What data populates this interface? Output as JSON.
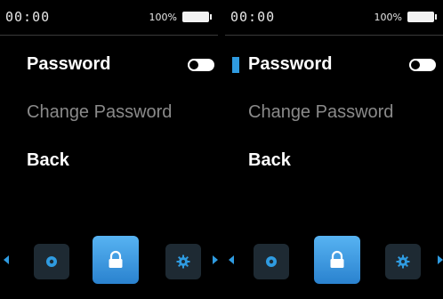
{
  "screens": [
    {
      "id": "left",
      "status": {
        "time": "00:00",
        "battery": "100%"
      },
      "menu": [
        {
          "label": "Password"
        },
        {
          "label": "Change Password"
        },
        {
          "label": "Back"
        }
      ],
      "password_toggle": "off",
      "focused": false
    },
    {
      "id": "right",
      "status": {
        "time": "00:00",
        "battery": "100%"
      },
      "menu": [
        {
          "label": "Password"
        },
        {
          "label": "Change Password"
        },
        {
          "label": "Back"
        }
      ],
      "password_toggle": "off",
      "focused": true
    }
  ],
  "nav": {
    "icons": [
      "eye-icon",
      "lock-icon",
      "gear-icon"
    ],
    "selected": "lock-icon"
  },
  "colors": {
    "accent": "#2f9be0",
    "disabled_text": "#8a8a8a",
    "tile_dark": "#1e2a33"
  }
}
